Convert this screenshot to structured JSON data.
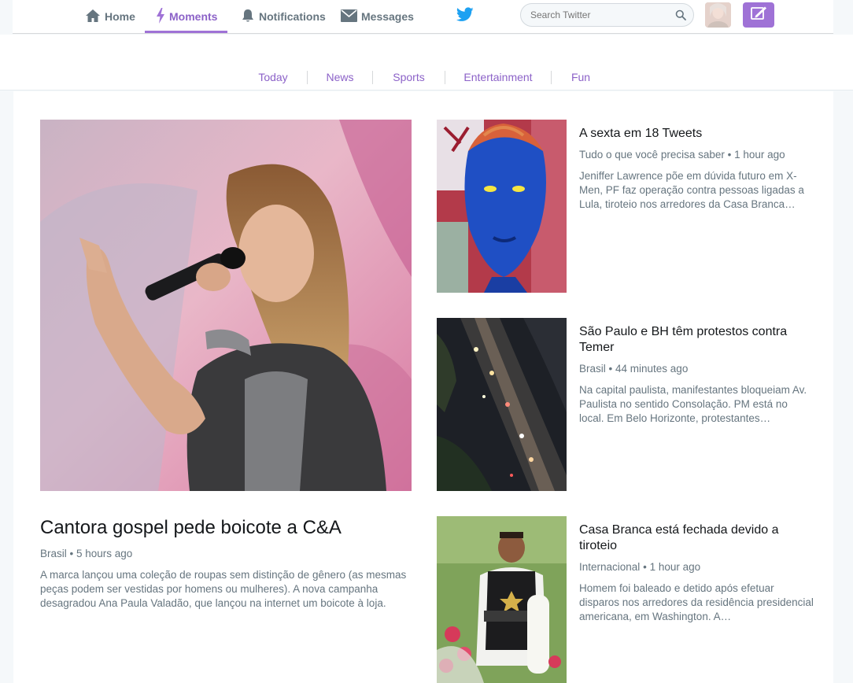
{
  "nav": {
    "home": "Home",
    "moments": "Moments",
    "notifications": "Notifications",
    "messages": "Messages",
    "search_placeholder": "Search Twitter"
  },
  "tabs": [
    {
      "label": "Today"
    },
    {
      "label": "News"
    },
    {
      "label": "Sports"
    },
    {
      "label": "Entertainment"
    },
    {
      "label": "Fun"
    }
  ],
  "hero": {
    "title": "Cantora gospel pede boicote a C&A",
    "category": "Brasil",
    "time": "5 hours ago",
    "description": "A marca lançou uma coleção de roupas sem distinção de gênero (as mesmas peças podem ser vestidas por homens ou mulheres). A nova campanha desagradou Ana Paula Valadão, que lançou na internet um boicote à loja."
  },
  "cards": [
    {
      "title": "A sexta em 18 Tweets",
      "category": "Tudo o que você precisa saber",
      "time": "1 hour ago",
      "description": "Jeniffer Lawrence põe em dúvida futuro em X-Men, PF faz operação contra pessoas ligadas a Lula, tiroteio nos arredores da Casa Branca…"
    },
    {
      "title": "São Paulo e BH têm protestos contra Temer",
      "category": "Brasil",
      "time": "44 minutes ago",
      "description": "Na capital paulista, manifestantes bloqueiam Av. Paulista no sentido Consolação. PM está no local. Em Belo Horizonte, protestantes…"
    },
    {
      "title": "Casa Branca está fechada devido a tiroteio",
      "category": "Internacional",
      "time": "1 hour ago",
      "description": "Homem foi baleado e detido após efetuar disparos nos arredores da residência presidencial americana, em Washington. A…"
    }
  ],
  "colors": {
    "accent": "#9f72d6",
    "accent_text": "#8c62c8",
    "twitter_blue": "#1da1f2",
    "muted": "#66757f"
  }
}
